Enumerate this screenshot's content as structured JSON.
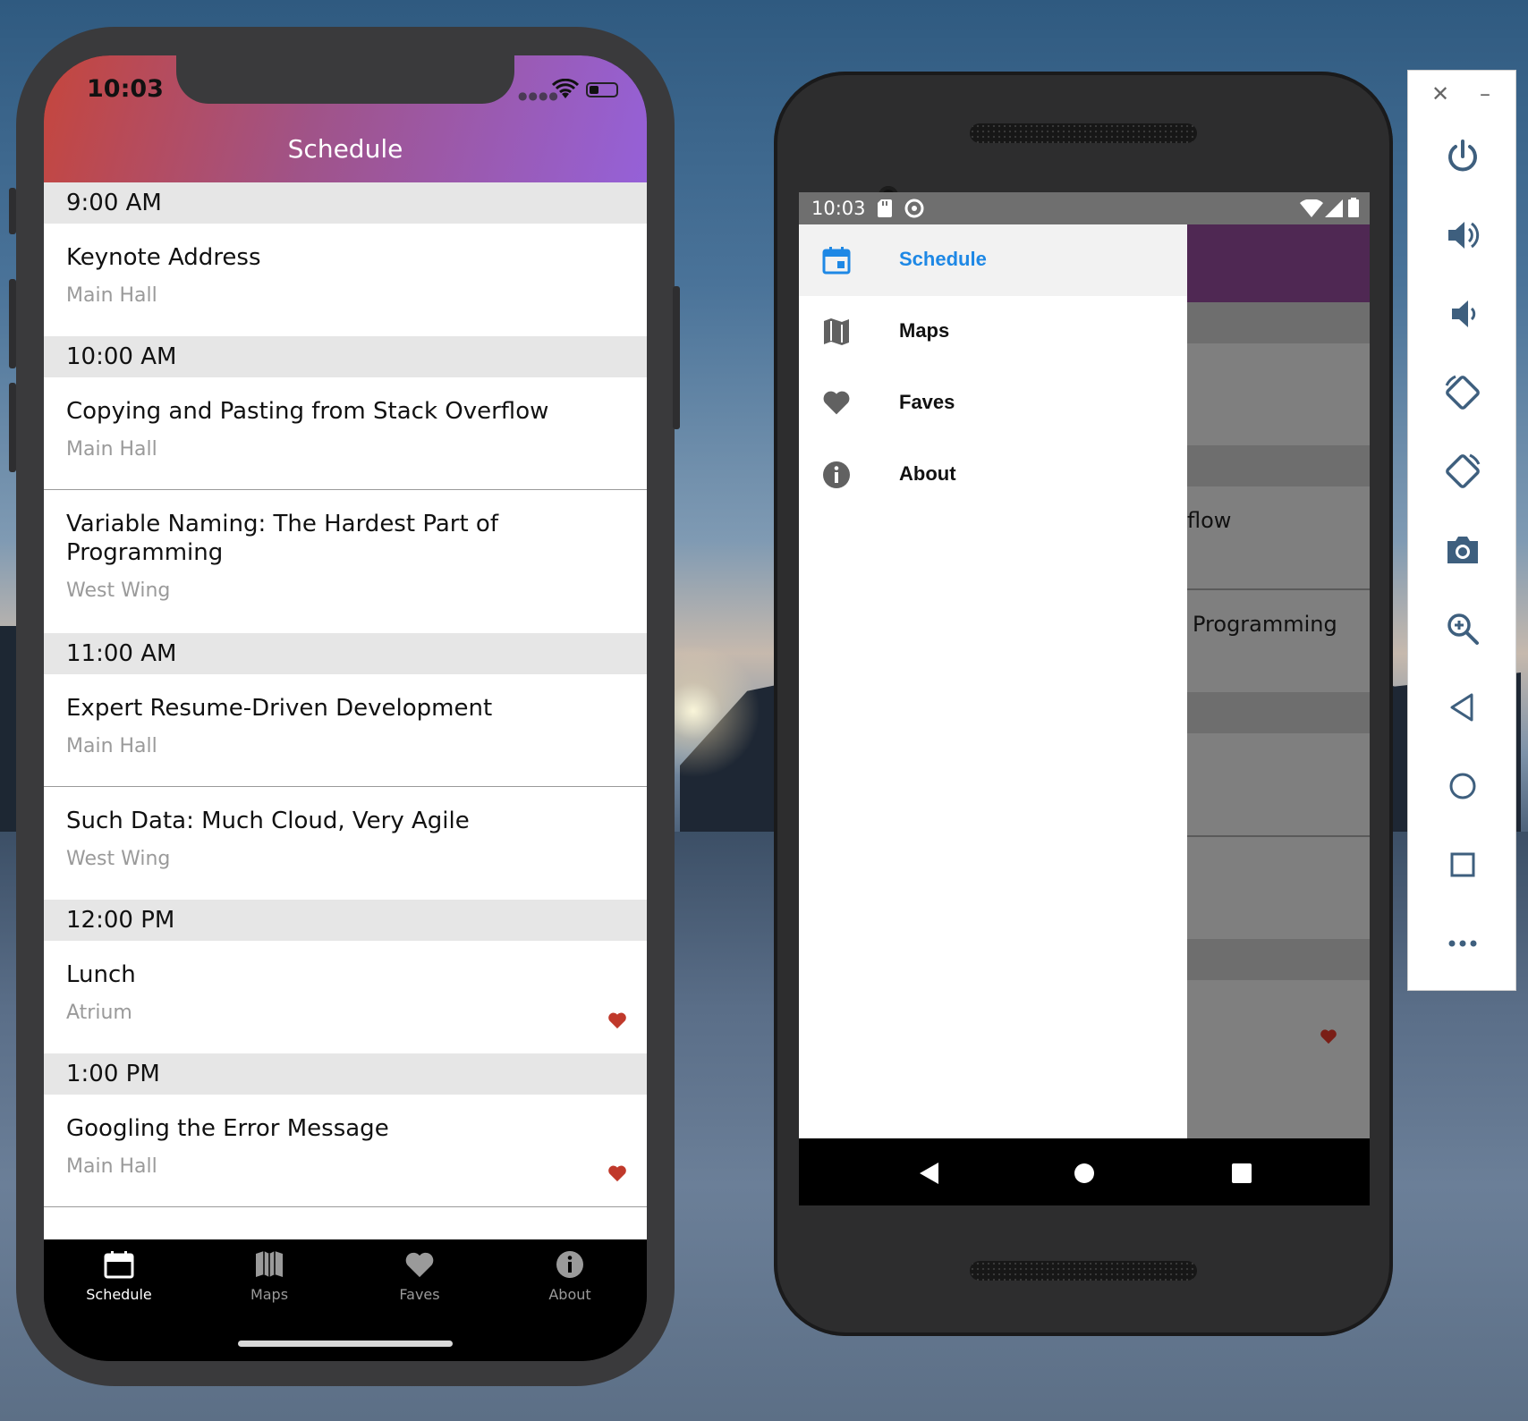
{
  "ios": {
    "status_time": "10:03",
    "title": "Schedule",
    "sections": [
      {
        "time": "9:00 AM",
        "sessions": [
          {
            "title": "Keynote Address",
            "room": "Main Hall",
            "fav": false
          }
        ]
      },
      {
        "time": "10:00 AM",
        "sessions": [
          {
            "title": "Copying and Pasting from Stack Overflow",
            "room": "Main Hall",
            "fav": false
          },
          {
            "title": "Variable Naming: The Hardest Part of Programming",
            "room": "West Wing",
            "fav": false
          }
        ]
      },
      {
        "time": "11:00 AM",
        "sessions": [
          {
            "title": "Expert Resume-Driven Development",
            "room": "Main Hall",
            "fav": false
          },
          {
            "title": "Such Data: Much Cloud, Very Agile",
            "room": "West Wing",
            "fav": false
          }
        ]
      },
      {
        "time": "12:00 PM",
        "sessions": [
          {
            "title": "Lunch",
            "room": "Atrium",
            "fav": true
          }
        ]
      },
      {
        "time": "1:00 PM",
        "sessions": [
          {
            "title": "Googling the Error Message",
            "room": "Main Hall",
            "fav": true
          }
        ]
      }
    ],
    "tabs": [
      {
        "label": "Schedule",
        "icon": "calendar-icon",
        "active": true
      },
      {
        "label": "Maps",
        "icon": "map-icon",
        "active": false
      },
      {
        "label": "Faves",
        "icon": "heart-icon",
        "active": false
      },
      {
        "label": "About",
        "icon": "info-icon",
        "active": false
      }
    ]
  },
  "android": {
    "status_time": "10:03",
    "drawer_items": [
      {
        "label": "Schedule",
        "icon": "calendar-icon",
        "selected": true
      },
      {
        "label": "Maps",
        "icon": "map-icon",
        "selected": false
      },
      {
        "label": "Faves",
        "icon": "heart-icon",
        "selected": false
      },
      {
        "label": "About",
        "icon": "info-icon",
        "selected": false
      }
    ],
    "peek_text": [
      "flow",
      "Programming"
    ]
  },
  "colors": {
    "header_gradient_start": "#c5463d",
    "header_gradient_end": "#9561d8",
    "favorite_heart": "#c0392b",
    "drawer_selected": "#1e88e5",
    "app_bar_android": "#4f2853"
  },
  "emulator_toolbar": {
    "buttons": [
      "close-icon",
      "minimize-icon",
      "power-icon",
      "volume-up-icon",
      "volume-down-icon",
      "rotate-left-icon",
      "rotate-right-icon",
      "camera-icon",
      "zoom-icon",
      "back-icon",
      "home-icon",
      "overview-icon",
      "more-icon"
    ]
  }
}
